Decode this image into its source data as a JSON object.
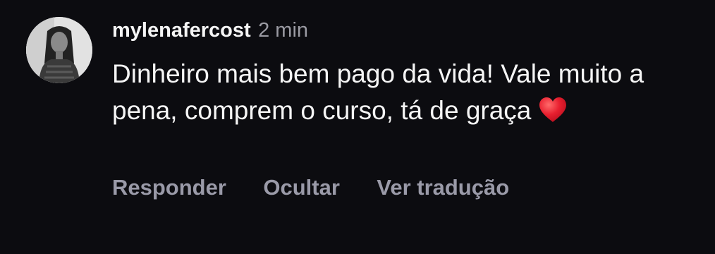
{
  "comment": {
    "username": "mylenafercost",
    "timestamp": "2 min",
    "text": "Dinheiro mais bem pago da vida! Vale muito a pena, comprem o curso, tá de graça",
    "emoji_icon": "red-heart-icon"
  },
  "actions": {
    "reply_label": "Responder",
    "hide_label": "Ocultar",
    "translate_label": "Ver tradução"
  },
  "colors": {
    "background": "#0c0c10",
    "primary_text": "#f5f5f5",
    "secondary_text": "#9a9aa8",
    "heart": "#e0172b"
  }
}
